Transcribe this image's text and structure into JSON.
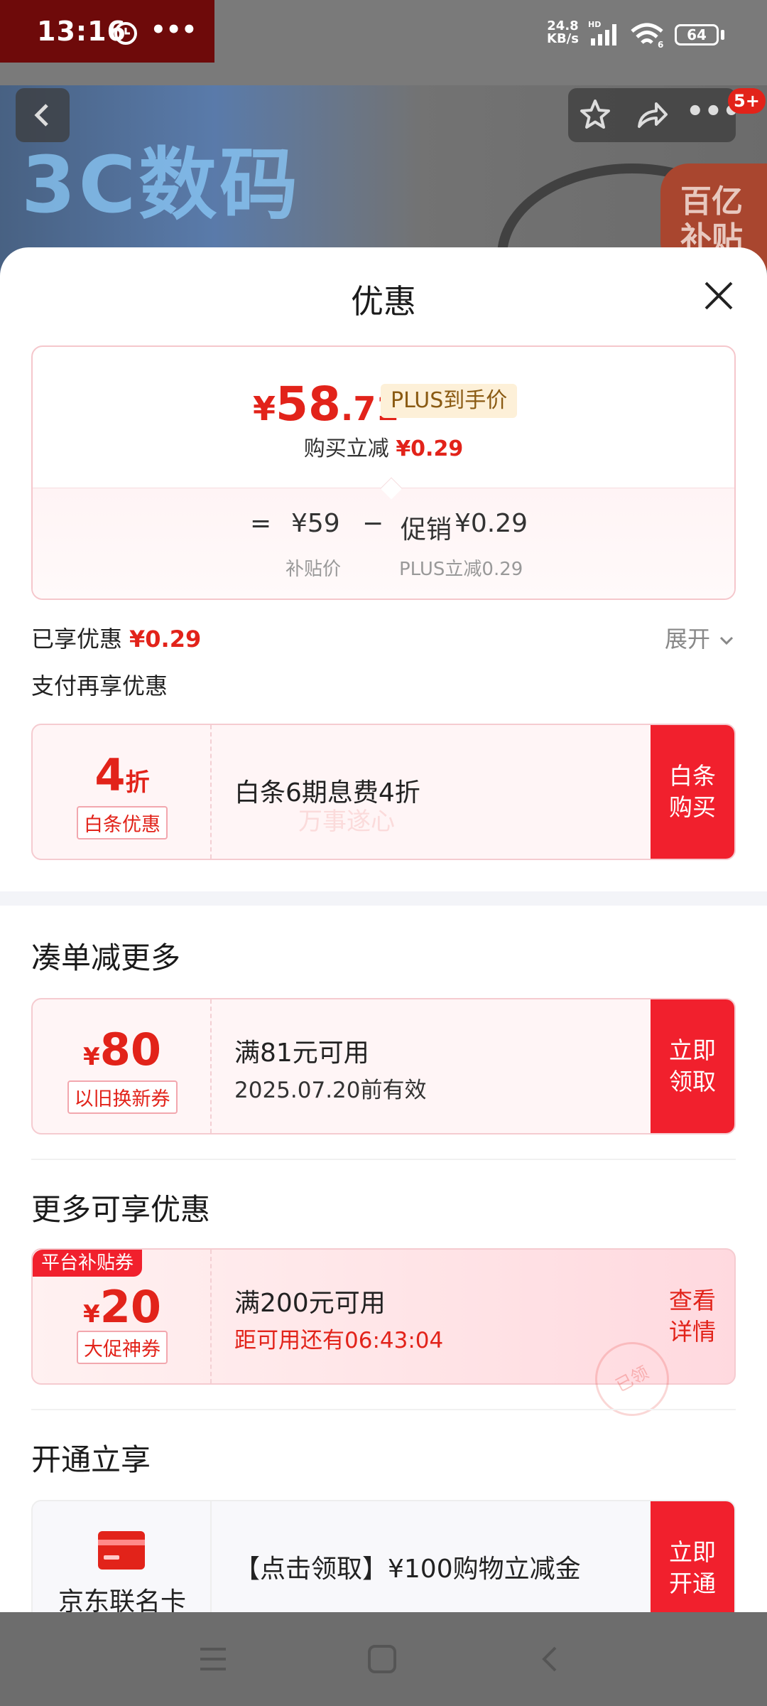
{
  "status_bar": {
    "time": "13:16",
    "net_speed_value": "24.8",
    "net_speed_unit": "KB/s",
    "battery": "64"
  },
  "background": {
    "banner_text": "3C数码",
    "badge_line1": "百亿",
    "badge_line2": "补贴",
    "notification_badge": "5+"
  },
  "sheet": {
    "title": "优惠"
  },
  "price_card": {
    "currency": "¥",
    "price_int": "58",
    "price_dec": ".71",
    "plus_tag": "PLUS到手价",
    "instant_cut_label": "购买立减",
    "instant_cut_value": "¥0.29",
    "equals": "=",
    "base_price": "¥59",
    "minus": "−",
    "promo_label": "促销",
    "promo_value": "¥0.29",
    "base_price_label": "补贴价",
    "promo_sub_label": "PLUS立减0.29"
  },
  "enjoyed": {
    "label": "已享优惠",
    "value": "¥0.29",
    "expand": "展开"
  },
  "pay_more": {
    "label": "支付再享优惠"
  },
  "baitiao_coupon": {
    "big": "4",
    "big_suffix": "折",
    "tag": "白条优惠",
    "main": "白条6期息费4折",
    "button_line1": "白条",
    "button_line2": "购买",
    "watermark": "万事遂心"
  },
  "section_combine": {
    "title": "凑单减更多"
  },
  "trade_in_coupon": {
    "currency": "¥",
    "amount": "80",
    "tag": "以旧换新券",
    "main": "满81元可用",
    "sub": "2025.07.20前有效",
    "button_line1": "立即",
    "button_line2": "领取"
  },
  "section_more": {
    "title": "更多可享优惠"
  },
  "promo_coupon": {
    "platform_tag": "平台补贴券",
    "currency": "¥",
    "amount": "20",
    "tag": "大促神券",
    "main": "满200元可用",
    "sub": "距可用还有06:43:04",
    "button_line1": "查看",
    "button_line2": "详情",
    "stamp": "已领"
  },
  "section_open": {
    "title": "开通立享"
  },
  "jd_card": {
    "name": "京东联名卡",
    "main": "【点击领取】¥100购物立减金",
    "button_line1": "立即",
    "button_line2": "开通"
  },
  "colors": {
    "accent_red": "#e2231a",
    "button_red": "#f1202d",
    "plus_gold": "#8a5a12"
  }
}
